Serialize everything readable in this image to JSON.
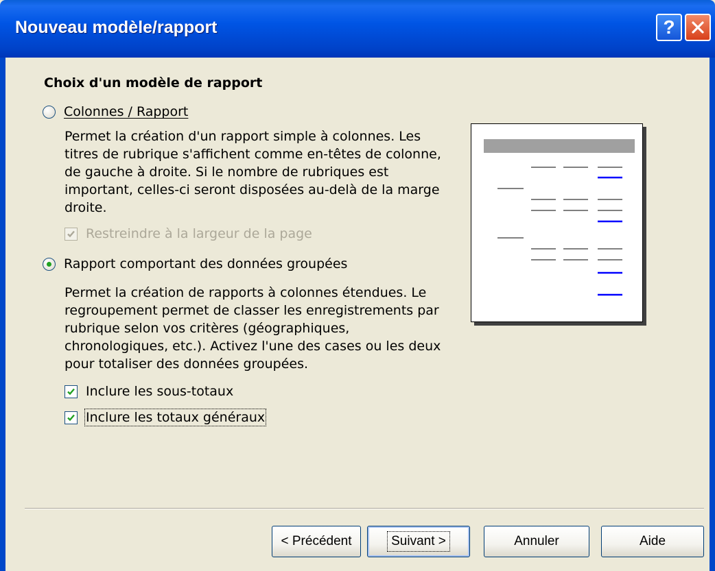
{
  "window": {
    "title": "Nouveau modèle/rapport"
  },
  "titlebar": {
    "help_glyph": "?",
    "close_icon": "close-icon"
  },
  "section_title": "Choix d'un modèle de rapport",
  "options": [
    {
      "label": "Colonnes / Rapport",
      "selected": false,
      "description": "Permet la création d'un rapport simple à colonnes.  Les titres de rubrique s'affichent comme en-têtes de colonne, de gauche à droite.  Si le nombre de rubriques est important, celles-ci seront disposées au-delà de la marge droite.",
      "checkboxes": [
        {
          "label": "Restreindre à la largeur de la page",
          "checked": true,
          "enabled": false
        }
      ]
    },
    {
      "label": "Rapport comportant des données groupées",
      "selected": true,
      "description": "Permet la création de rapports à colonnes étendues. Le regroupement permet de classer les enregistrements par rubrique selon vos critères (géographiques, chronologiques, etc.). Activez l'une des cases ou les deux pour totaliser des données groupées.",
      "checkboxes": [
        {
          "label": "Inclure les sous-totaux",
          "checked": true,
          "enabled": true
        },
        {
          "label": "Inclure les totaux généraux",
          "checked": true,
          "enabled": true,
          "focused": true
        }
      ]
    }
  ],
  "preview": {
    "header_color": "#a0a0a0",
    "line_color": "#808080",
    "total_color": "#0000ff"
  },
  "buttons": {
    "back": "< Précédent",
    "next": "Suivant >",
    "cancel": "Annuler",
    "help": "Aide"
  },
  "colors": {
    "titlebar": "#0055e5",
    "dialog_bg": "#ece9d8",
    "radio_dot": "#21a121"
  }
}
